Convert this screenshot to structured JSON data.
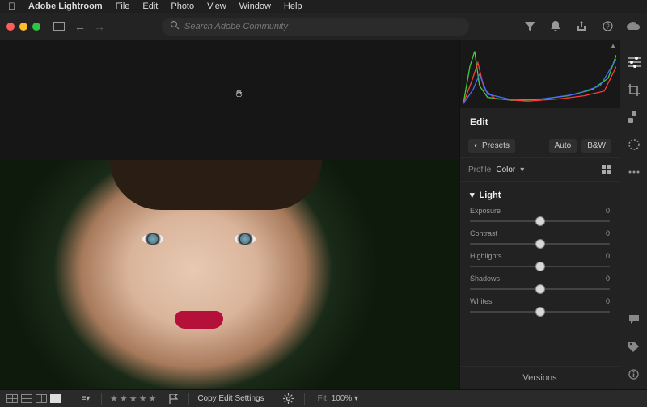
{
  "menubar": {
    "app": "Adobe Lightroom",
    "items": [
      "File",
      "Edit",
      "Photo",
      "View",
      "Window",
      "Help"
    ]
  },
  "toolbar": {
    "search_placeholder": "Search Adobe Community"
  },
  "panel": {
    "edit_title": "Edit",
    "presets_label": "Presets",
    "auto_label": "Auto",
    "bw_label": "B&W",
    "profile_key": "Profile",
    "profile_value": "Color",
    "light_section": "Light",
    "sliders": [
      {
        "label": "Exposure",
        "value": "0"
      },
      {
        "label": "Contrast",
        "value": "0"
      },
      {
        "label": "Highlights",
        "value": "0"
      },
      {
        "label": "Shadows",
        "value": "0"
      },
      {
        "label": "Whites",
        "value": "0"
      }
    ],
    "versions_label": "Versions"
  },
  "bottombar": {
    "copy_label": "Copy Edit Settings",
    "fit_label": "Fit",
    "zoom_value": "100%"
  }
}
